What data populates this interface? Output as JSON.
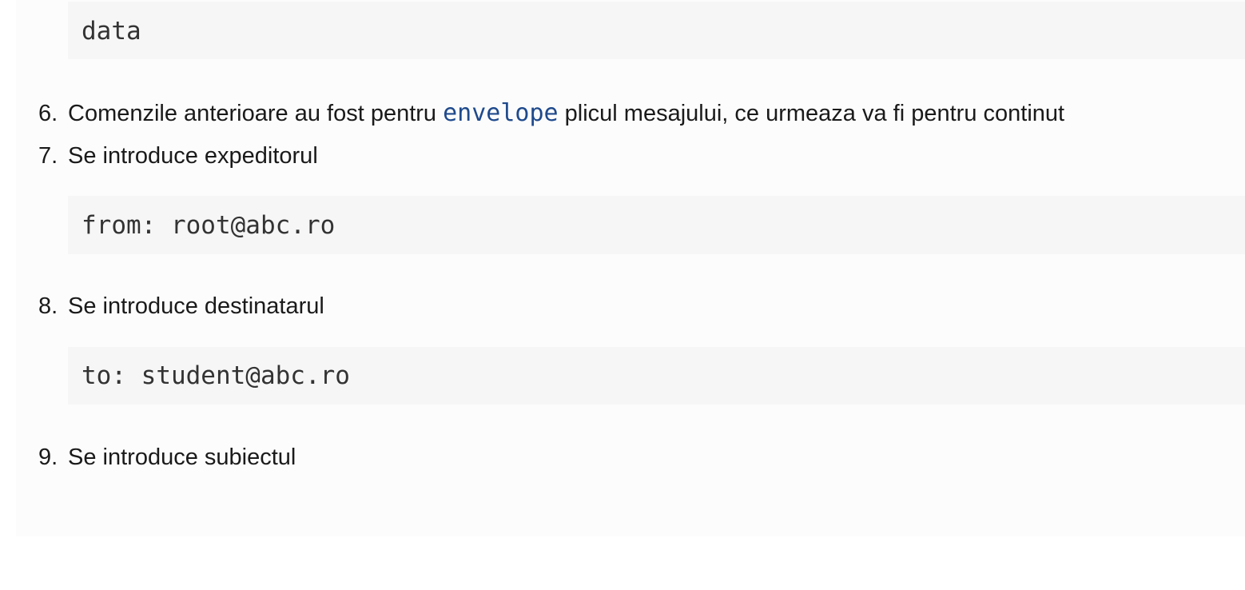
{
  "code_blocks": [
    "data",
    "from: root@abc.ro",
    "to: student@abc.ro"
  ],
  "steps": {
    "s6": {
      "number": "6.",
      "before": "Comenzile anterioare au fost pentru ",
      "code": "envelope",
      "after": " plicul mesajului, ce urmeaza va fi pentru continut"
    },
    "s7": {
      "number": "7.",
      "text": "Se introduce expeditorul"
    },
    "s8": {
      "number": "8.",
      "text": "Se introduce destinatarul"
    },
    "s9": {
      "number": "9.",
      "text": "Se introduce subiectul"
    }
  },
  "colors": {
    "panel_background": "#fcfcfc",
    "code_background": "#f6f6f6",
    "inline_code": "#1f4a8c"
  }
}
